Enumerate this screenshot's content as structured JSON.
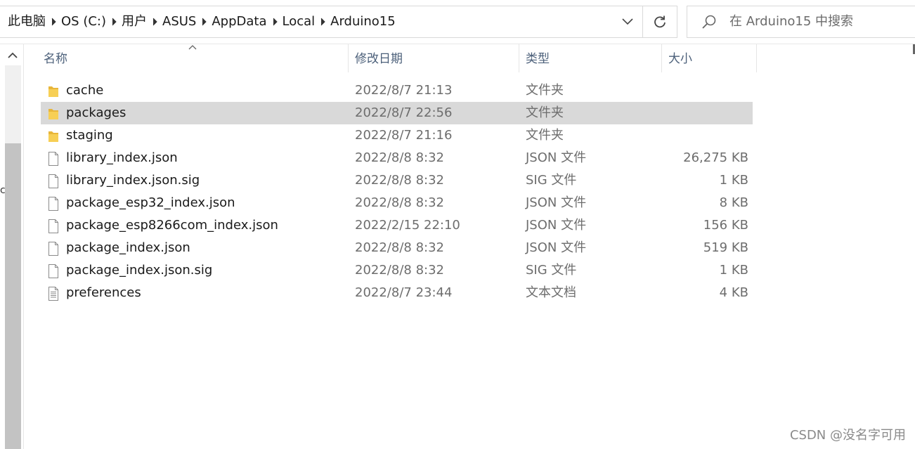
{
  "breadcrumb": [
    "此电脑",
    "OS (C:)",
    "用户",
    "ASUS",
    "AppData",
    "Local",
    "Arduino15"
  ],
  "search": {
    "placeholder": "在 Arduino15 中搜索"
  },
  "columns": {
    "name": "名称",
    "date": "修改日期",
    "type": "类型",
    "size": "大小"
  },
  "nav_fragment": "c",
  "files": [
    {
      "name": "cache",
      "date": "2022/8/7 21:13",
      "type": "文件夹",
      "size": "",
      "icon": "folder-icon",
      "selected": false
    },
    {
      "name": "packages",
      "date": "2022/8/7 22:56",
      "type": "文件夹",
      "size": "",
      "icon": "folder-icon",
      "selected": true
    },
    {
      "name": "staging",
      "date": "2022/8/7 21:16",
      "type": "文件夹",
      "size": "",
      "icon": "folder-icon",
      "selected": false
    },
    {
      "name": "library_index.json",
      "date": "2022/8/8 8:32",
      "type": "JSON 文件",
      "size": "26,275 KB",
      "icon": "file-icon",
      "selected": false
    },
    {
      "name": "library_index.json.sig",
      "date": "2022/8/8 8:32",
      "type": "SIG 文件",
      "size": "1 KB",
      "icon": "file-icon",
      "selected": false
    },
    {
      "name": "package_esp32_index.json",
      "date": "2022/8/8 8:32",
      "type": "JSON 文件",
      "size": "8 KB",
      "icon": "file-icon",
      "selected": false
    },
    {
      "name": "package_esp8266com_index.json",
      "date": "2022/2/15 22:10",
      "type": "JSON 文件",
      "size": "156 KB",
      "icon": "file-icon",
      "selected": false
    },
    {
      "name": "package_index.json",
      "date": "2022/8/8 8:32",
      "type": "JSON 文件",
      "size": "519 KB",
      "icon": "file-icon",
      "selected": false
    },
    {
      "name": "package_index.json.sig",
      "date": "2022/8/8 8:32",
      "type": "SIG 文件",
      "size": "1 KB",
      "icon": "file-icon",
      "selected": false
    },
    {
      "name": "preferences",
      "date": "2022/8/7 23:44",
      "type": "文本文档",
      "size": "4 KB",
      "icon": "text-file-icon",
      "selected": false
    }
  ],
  "watermark": "CSDN @没名字可用",
  "colors": {
    "selected_row": "#d9d9d9",
    "folder": "#f0c14b",
    "header_text": "#4c607a"
  }
}
